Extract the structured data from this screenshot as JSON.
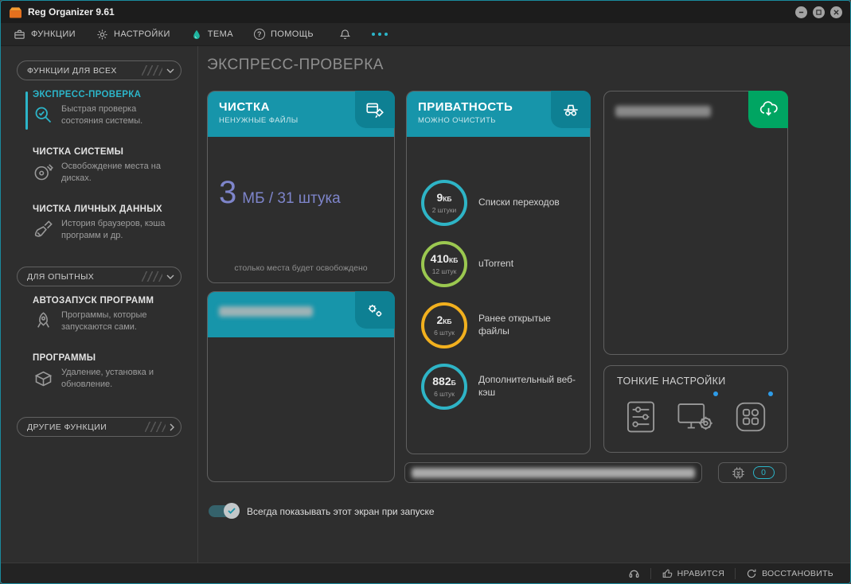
{
  "colors": {
    "header_teal": "#1795aa",
    "badge_teal": "#0e8093",
    "badge_green": "#00a562",
    "value_purple": "#7e85cb",
    "accent": "#2cb5c9",
    "notification_blue": "#2e9ce8"
  },
  "window": {
    "title": "Reg Organizer 9.61"
  },
  "menubar": {
    "functions": "ФУНКЦИИ",
    "settings": "НАСТРОЙКИ",
    "theme": "ТЕМА",
    "help": "ПОМОЩЬ",
    "help_q": "?"
  },
  "sidebar": {
    "groups": [
      {
        "header": "ФУНКЦИИ ДЛЯ ВСЕХ",
        "items": [
          {
            "title": "ЭКСПРЕСС-ПРОВЕРКА",
            "desc": "Быстрая проверка состояния системы."
          },
          {
            "title": "ЧИСТКА СИСТЕМЫ",
            "desc": "Освобождение места на дисках."
          },
          {
            "title": "ЧИСТКА ЛИЧНЫХ ДАННЫХ",
            "desc": "История браузеров, кэша программ и др."
          }
        ]
      },
      {
        "header": "ДЛЯ ОПЫТНЫХ",
        "items": [
          {
            "title": "АВТОЗАПУСК ПРОГРАММ",
            "desc": "Программы, которые запускаются сами."
          },
          {
            "title": "ПРОГРАММЫ",
            "desc": "Удаление, установка и обновление."
          }
        ]
      }
    ],
    "other_functions": "ДРУГИЕ ФУНКЦИИ"
  },
  "main": {
    "page_title": "ЭКСПРЕСС-ПРОВЕРКА",
    "cleaning": {
      "title": "ЧИСТКА",
      "subtitle": "НЕНУЖНЫЕ ФАЙЛЫ",
      "value": "3",
      "unit": "МБ / 31 штука",
      "footer": "столько места будет освобождено"
    },
    "privacy": {
      "title": "ПРИВАТНОСТЬ",
      "subtitle": "МОЖНО ОЧИСТИТЬ",
      "rings": [
        {
          "num": "9",
          "unit": "КБ",
          "count": "2 штуки",
          "label": "Списки переходов",
          "color": "#2eb4c6"
        },
        {
          "num": "410",
          "unit": "КБ",
          "count": "12 штук",
          "label": "uTorrent",
          "color": "#9bc850"
        },
        {
          "num": "2",
          "unit": "КБ",
          "count": "6 штук",
          "label": "Ранее открытые файлы",
          "color": "#f2b01e"
        },
        {
          "num": "882",
          "unit": "Б",
          "count": "6 штук",
          "label": "Дополнительный веб-кэш",
          "color": "#2eb4c6"
        }
      ]
    },
    "fine_settings": {
      "title": "ТОНКИЕ НАСТРОЙКИ"
    },
    "chip_count": "0",
    "toggle_label": "Всегда показывать этот экран при запуске"
  },
  "statusbar": {
    "like": "НРАВИТСЯ",
    "restore": "ВОССТАНОВИТЬ"
  }
}
